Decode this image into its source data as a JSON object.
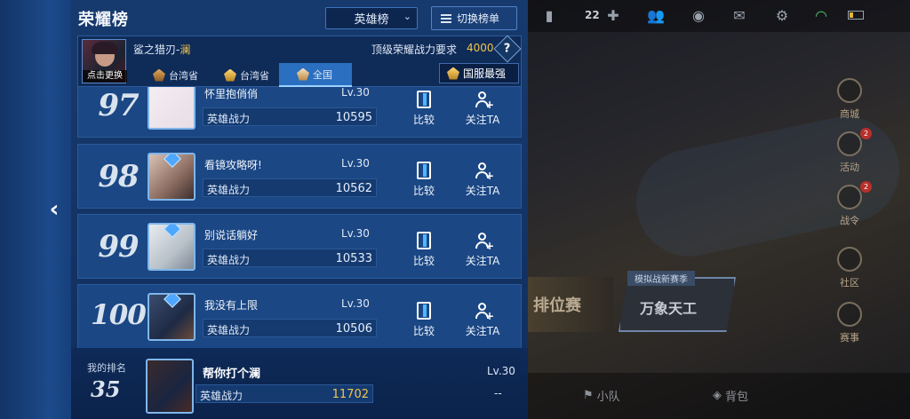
{
  "panel": {
    "title": "荣耀榜",
    "board_select": "英雄榜",
    "switch_button": "切换榜单"
  },
  "profile": {
    "name_prefix": "鲨之猎刃-",
    "name_hero": "澜",
    "change_label": "点击更换",
    "requirement_label": "顶级荣耀战力要求",
    "requirement_value": "4000",
    "tabs": [
      {
        "label": "台湾省",
        "active": false
      },
      {
        "label": "台湾省",
        "active": false
      },
      {
        "label": "全国",
        "active": true
      }
    ],
    "server_button": "国服最强"
  },
  "rows": [
    {
      "rank": "97",
      "name": "怀里抱俏俏",
      "level": "Lv.30",
      "power_label": "英雄战力",
      "power": "10595",
      "compare": "比较",
      "follow": "关注TA"
    },
    {
      "rank": "98",
      "name": "看镜攻略呀!",
      "level": "Lv.30",
      "power_label": "英雄战力",
      "power": "10562",
      "compare": "比较",
      "follow": "关注TA"
    },
    {
      "rank": "99",
      "name": "别说话躺好",
      "level": "Lv.30",
      "power_label": "英雄战力",
      "power": "10533",
      "compare": "比较",
      "follow": "关注TA"
    },
    {
      "rank": "100",
      "name": "我没有上限",
      "level": "Lv.30",
      "power_label": "英雄战力",
      "power": "10506",
      "compare": "比较",
      "follow": "关注TA"
    }
  ],
  "my_rank": {
    "label": "我的排名",
    "rank": "35",
    "name": "帮你打个澜",
    "level": "Lv.30",
    "power_label": "英雄战力",
    "power": "11702",
    "dash": "--"
  },
  "lobby": {
    "coin_count": "22",
    "side_menu": [
      {
        "label": "商城",
        "badge": ""
      },
      {
        "label": "活动",
        "badge": "2"
      },
      {
        "label": "战令",
        "badge": "2"
      },
      {
        "label": "社区",
        "badge": ""
      },
      {
        "label": "赛事",
        "badge": ""
      }
    ],
    "mode_left": "排位赛",
    "mode_right": "万象天工",
    "mode_tag": "模拟战新赛季",
    "bottom_team": "小队",
    "bottom_bag": "背包"
  },
  "colors": {
    "accent_gold": "#f1c64a",
    "panel_blue": "#173a6e",
    "tab_active": "#2b6fc0"
  }
}
